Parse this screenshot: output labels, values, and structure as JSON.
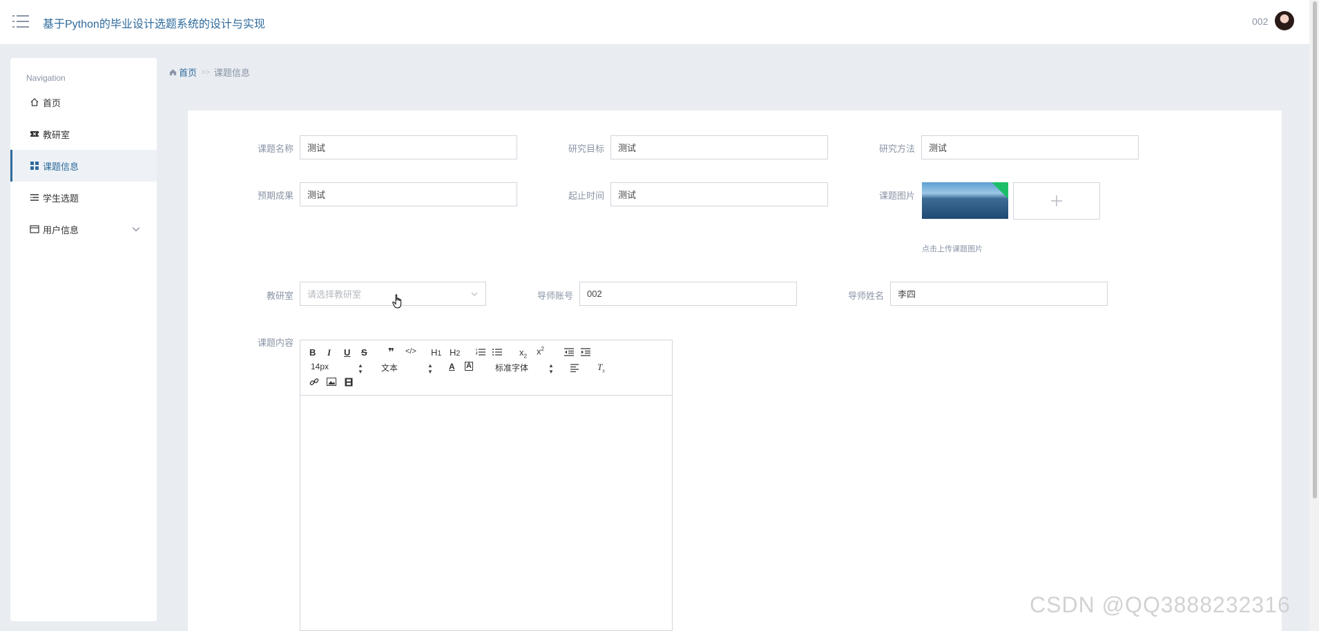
{
  "header": {
    "app_title": "基于Python的毕业设计选题系统的设计与实现",
    "user_name": "002"
  },
  "sidebar": {
    "nav_title": "Navigation",
    "items": [
      {
        "label": "首页",
        "icon": "home-icon"
      },
      {
        "label": "教研室",
        "icon": "ticket-icon"
      },
      {
        "label": "课题信息",
        "icon": "grid-icon",
        "active": true
      },
      {
        "label": "学生选题",
        "icon": "list-icon"
      },
      {
        "label": "用户信息",
        "icon": "window-icon",
        "expandable": true
      }
    ]
  },
  "breadcrumb": {
    "home": "首页",
    "separator": ">>",
    "current": "课题信息"
  },
  "form": {
    "topic_name": {
      "label": "课题名称",
      "value": "测试"
    },
    "research_goal": {
      "label": "研究目标",
      "value": "测试"
    },
    "research_method": {
      "label": "研究方法",
      "value": "测试"
    },
    "expected_result": {
      "label": "预期成果",
      "value": "测试"
    },
    "time_range": {
      "label": "起止时间",
      "value": "测试"
    },
    "topic_image": {
      "label": "课题图片",
      "hint": "点击上传课题图片"
    },
    "office": {
      "label": "教研室",
      "placeholder": "请选择教研室"
    },
    "tutor_account": {
      "label": "导师账号",
      "value": "002"
    },
    "tutor_name": {
      "label": "导师姓名",
      "value": "李四"
    },
    "topic_content": {
      "label": "课题内容"
    }
  },
  "editor": {
    "font_size": "14px",
    "text_type": "文本",
    "font_family": "标准字体"
  },
  "watermark": "CSDN @QQ3888232316",
  "colors": {
    "accent": "#2d6a9c",
    "page_bg": "#e9ecf1"
  }
}
